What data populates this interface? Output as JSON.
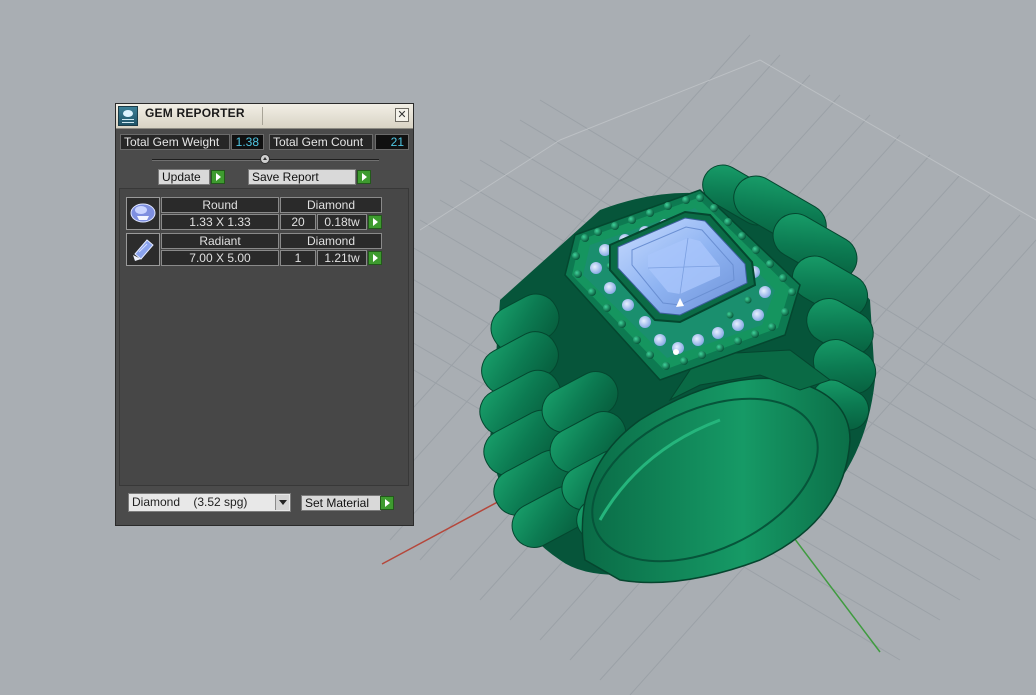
{
  "panel": {
    "title": "GEM REPORTER",
    "close_label": "✕",
    "total_weight_label": "Total Gem Weight",
    "total_weight_value": "1.38",
    "total_count_label": "Total Gem Count",
    "total_count_value": "21",
    "update_label": "Update",
    "save_report_label": "Save Report",
    "gems": [
      {
        "shape": "Round",
        "material": "Diamond",
        "size": "1.33 X 1.33",
        "count": "20",
        "weight": "0.18tw"
      },
      {
        "shape": "Radiant",
        "material": "Diamond",
        "size": "7.00 X 5.00",
        "count": "1",
        "weight": "1.21tw"
      }
    ],
    "material_select": "Diamond    (3.52 spg)",
    "set_material_label": "Set Material"
  },
  "colors": {
    "ring_green": "#0f8a5c",
    "gem_blue": "#8fb4f2",
    "viewport_bg": "#a9aeb3",
    "accent_cyan": "#4fc6e3",
    "button_green": "#3e9b2f"
  },
  "icons": [
    "gem-reporter-icon",
    "close-icon",
    "slider-knob-icon",
    "go-arrow-icon",
    "round-gem-icon",
    "radiant-gem-icon",
    "dropdown-arrow-icon"
  ]
}
